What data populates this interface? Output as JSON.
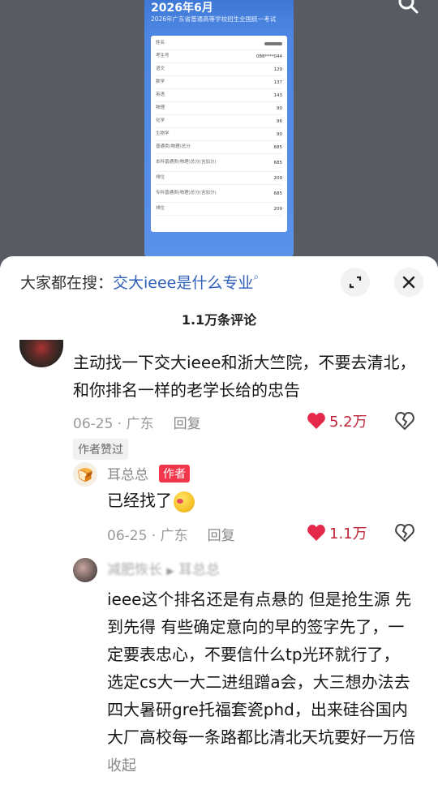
{
  "video": {
    "title": "2026年6月",
    "subtitle": "2026年广东省普通高等学校招生全国统一考试",
    "rows": [
      {
        "label": "姓名",
        "value": ""
      },
      {
        "label": "考生号",
        "value": "088****044"
      },
      {
        "label": "语文",
        "value": "129"
      },
      {
        "label": "数学",
        "value": "137"
      },
      {
        "label": "英语",
        "value": "143"
      },
      {
        "label": "物理",
        "value": "90"
      },
      {
        "label": "化学",
        "value": "96"
      },
      {
        "label": "生物学",
        "value": "90"
      },
      {
        "label": "普通类(物理)总分",
        "value": "685"
      },
      {
        "label": "本科普通类(物理)总分(含加分)",
        "value": "685"
      },
      {
        "label": "排位",
        "value": "209"
      },
      {
        "label": "专科普通类(物理)总分(含加分)",
        "value": "685"
      },
      {
        "label": "排位",
        "value": "209"
      }
    ]
  },
  "search": {
    "prefix": "大家都在搜：",
    "keyword": "交大ieee是什么专业"
  },
  "comments_count": "1.1万条评论",
  "comments": [
    {
      "text": "主动找一下交大ieee和浙大竺院，不要去清北，和你排名一样的老学长给的忠告",
      "date_loc": "06-25 · 广东",
      "reply": "回复",
      "likes": "5.2万",
      "badge": "作者赞过"
    },
    {
      "author": "耳总总",
      "author_badge": "作者",
      "text": "已经找了",
      "date_loc": "06-25 · 广东",
      "reply": "回复",
      "likes": "1.1万"
    },
    {
      "author": "减肥恢长",
      "reply_to": "耳总总",
      "text": "ieee这个排名还是有点悬的 但是抢生源 先到先得 有些确定意向的早的签字先了，一定要表忠心，不要信什么tp光环就行了，选定cs大一大二进组蹭a会，大三想办法去四大暑研gre托福套瓷phd，出来硅谷国内大厂高校每一条路都比清北天坑要好一万倍",
      "collapse": "收起"
    }
  ],
  "colors": {
    "like": "#c0243a",
    "keyword": "#2d5fb8",
    "author_badge": "#f2364c"
  }
}
